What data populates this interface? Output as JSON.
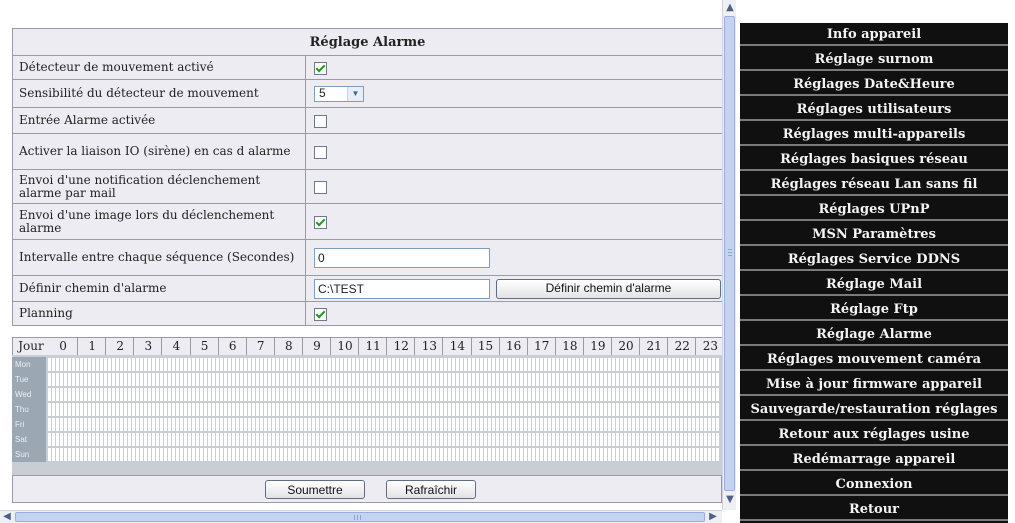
{
  "form": {
    "title": "Réglage Alarme",
    "rows": [
      {
        "label": "Détecteur de mouvement activé",
        "type": "checkbox",
        "checked": true
      },
      {
        "label": "Sensibilité du détecteur de mouvement",
        "type": "select",
        "value": "5"
      },
      {
        "label": "Entrée Alarme activée",
        "type": "checkbox",
        "checked": false
      },
      {
        "label": "Activer la liaison IO (sirène) en cas d alarme",
        "type": "checkbox",
        "checked": false
      },
      {
        "label": "Envoi d'une notification déclenchement alarme par mail",
        "type": "checkbox",
        "checked": false
      },
      {
        "label": "Envoi d'une image lors du déclenchement alarme",
        "type": "checkbox",
        "checked": true
      },
      {
        "label": "Intervalle entre chaque séquence (Secondes)",
        "type": "text",
        "value": "0"
      },
      {
        "label": "Définir chemin d'alarme",
        "type": "path",
        "value": "C:\\TEST",
        "button": "Définir chemin d'alarme"
      },
      {
        "label": "Planning",
        "type": "checkbox",
        "checked": true
      }
    ]
  },
  "schedule": {
    "day_header": "Jour",
    "hours": [
      "0",
      "1",
      "2",
      "3",
      "4",
      "5",
      "6",
      "7",
      "8",
      "9",
      "10",
      "11",
      "12",
      "13",
      "14",
      "15",
      "16",
      "17",
      "18",
      "19",
      "20",
      "21",
      "22",
      "23"
    ],
    "days": [
      "Mon",
      "Tue",
      "Wed",
      "Thu",
      "Fri",
      "Sat",
      "Sun"
    ]
  },
  "actions": {
    "submit": "Soumettre",
    "refresh": "Rafraîchir"
  },
  "menu": [
    "Info appareil",
    "Réglage surnom",
    "Réglages Date&Heure",
    "Réglages utilisateurs",
    "Réglages multi-appareils",
    "Réglages basiques réseau",
    "Réglages réseau Lan sans fil",
    "Réglages UPnP",
    "MSN Paramètres",
    "Réglages Service DDNS",
    "Réglage Mail",
    "Réglage Ftp",
    "Réglage Alarme",
    "Réglages mouvement caméra",
    "Mise à jour firmware appareil",
    "Sauvegarde/restauration réglages",
    "Retour aux réglages usine",
    "Redémarrage appareil",
    "Connexion",
    "Retour"
  ]
}
